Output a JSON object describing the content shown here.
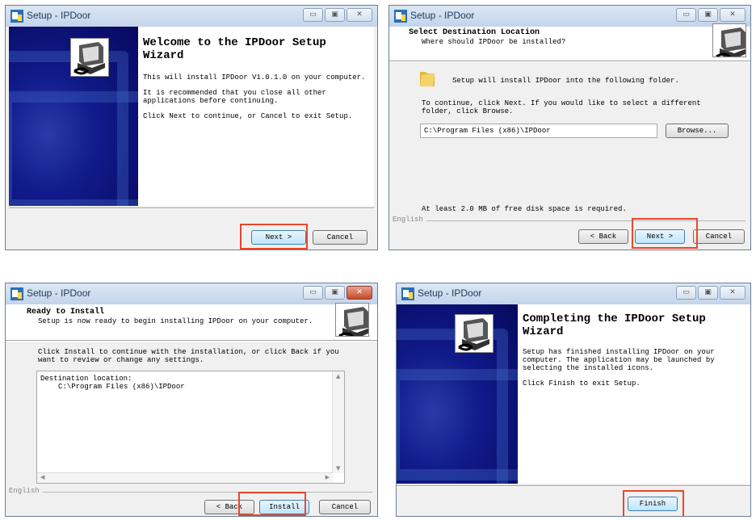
{
  "window_title": "Setup - IPDoor",
  "window_controls": {
    "minimize": "▭",
    "maximize": "▣",
    "close": "✕"
  },
  "brand_label": "English",
  "welcome": {
    "title": "Welcome to the IPDoor Setup Wizard",
    "p1": "This will install IPDoor V1.0.1.0 on your computer.",
    "p2": "It is recommended that you close all other applications before continuing.",
    "p3": "Click Next to continue, or Cancel to exit Setup.",
    "next": "Next >",
    "cancel": "Cancel"
  },
  "destination": {
    "title": "Select Destination Location",
    "subtitle": "Where should IPDoor be installed?",
    "line1": "Setup will install IPDoor into the following folder.",
    "line2": "To continue, click Next. If you would like to select a different folder, click Browse.",
    "path": "C:\\Program Files (x86)\\IPDoor",
    "browse": "Browse...",
    "space": "At least 2.0 MB of free disk space is required.",
    "back": "< Back",
    "next": "Next >",
    "cancel": "Cancel"
  },
  "ready": {
    "title": "Ready to Install",
    "subtitle": "Setup is now ready to begin installing IPDoor on your computer.",
    "instruction": "Click Install to continue with the installation, or click Back if you want to review or change any settings.",
    "memo_label": "Destination location:",
    "memo_path": "C:\\Program Files (x86)\\IPDoor",
    "back": "< Back",
    "install": "Install",
    "cancel": "Cancel"
  },
  "finish": {
    "title": "Completing the IPDoor Setup Wizard",
    "p1": "Setup has finished installing IPDoor on your computer. The application may be launched by selecting the installed icons.",
    "p2": "Click Finish to exit Setup.",
    "finish": "Finish"
  },
  "colors": {
    "highlight": "#e8472a",
    "sidebar": "#0a0d7a"
  }
}
